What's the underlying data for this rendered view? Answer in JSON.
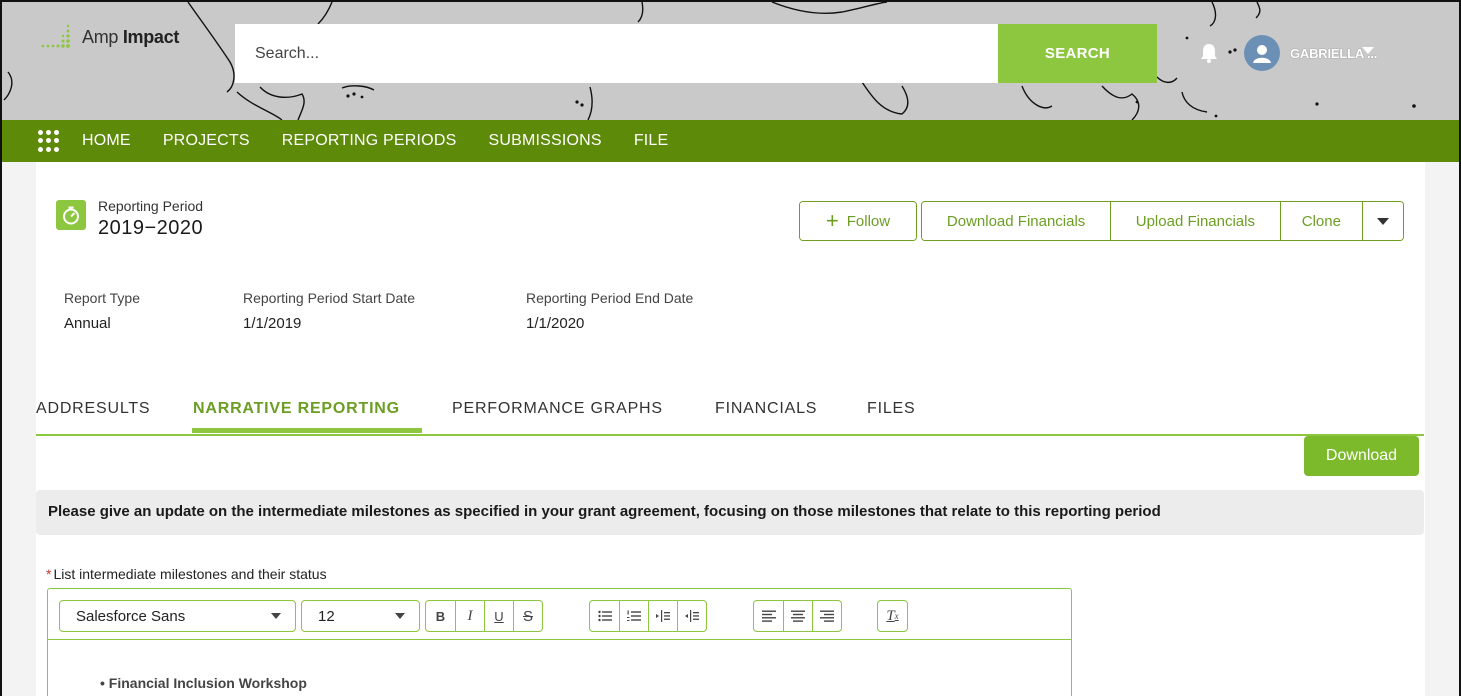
{
  "header": {
    "logo_light": "Amp",
    "logo_bold": "Impact",
    "search_placeholder": "Search...",
    "search_button": "SEARCH",
    "user_name": "GABRIELLA ...",
    "icons": [
      "bell-icon",
      "user-avatar-icon",
      "chevron-down-icon"
    ]
  },
  "nav": {
    "items": [
      "HOME",
      "PROJECTS",
      "REPORTING PERIODS",
      "SUBMISSIONS",
      "FILE"
    ]
  },
  "record": {
    "object_label": "Reporting Period",
    "title": "2019−2020",
    "icon": "stopwatch-icon",
    "actions": {
      "follow": "Follow",
      "download_financials": "Download Financials",
      "upload_financials": "Upload Financials",
      "clone": "Clone"
    }
  },
  "fields": [
    {
      "label": "Report Type",
      "value": "Annual"
    },
    {
      "label": "Reporting Period Start Date",
      "value": "1/1/2019"
    },
    {
      "label": "Reporting Period End Date",
      "value": "1/1/2020"
    }
  ],
  "tabs": [
    {
      "label": "ADDRESULTS",
      "active": false
    },
    {
      "label": "NARRATIVE REPORTING",
      "active": true
    },
    {
      "label": "PERFORMANCE GRAPHS",
      "active": false
    },
    {
      "label": "FINANCIALS",
      "active": false
    },
    {
      "label": "FILES",
      "active": false
    }
  ],
  "content": {
    "download_button": "Download",
    "question": "Please give an update on the intermediate milestones as specified in your grant agreement, focusing on those milestones that relate to this reporting period",
    "field_required_mark": "*",
    "field_label": "List intermediate milestones and their status",
    "editor": {
      "font_family_value": "Salesforce Sans",
      "font_size_value": "12",
      "bullet_text": "• Financial Inclusion Workshop"
    }
  },
  "colors": {
    "brand_green": "#8dc63f",
    "nav_green": "#5e8a0a",
    "header_gray": "#c9c9c9",
    "action_text_green": "#6c9e24"
  }
}
